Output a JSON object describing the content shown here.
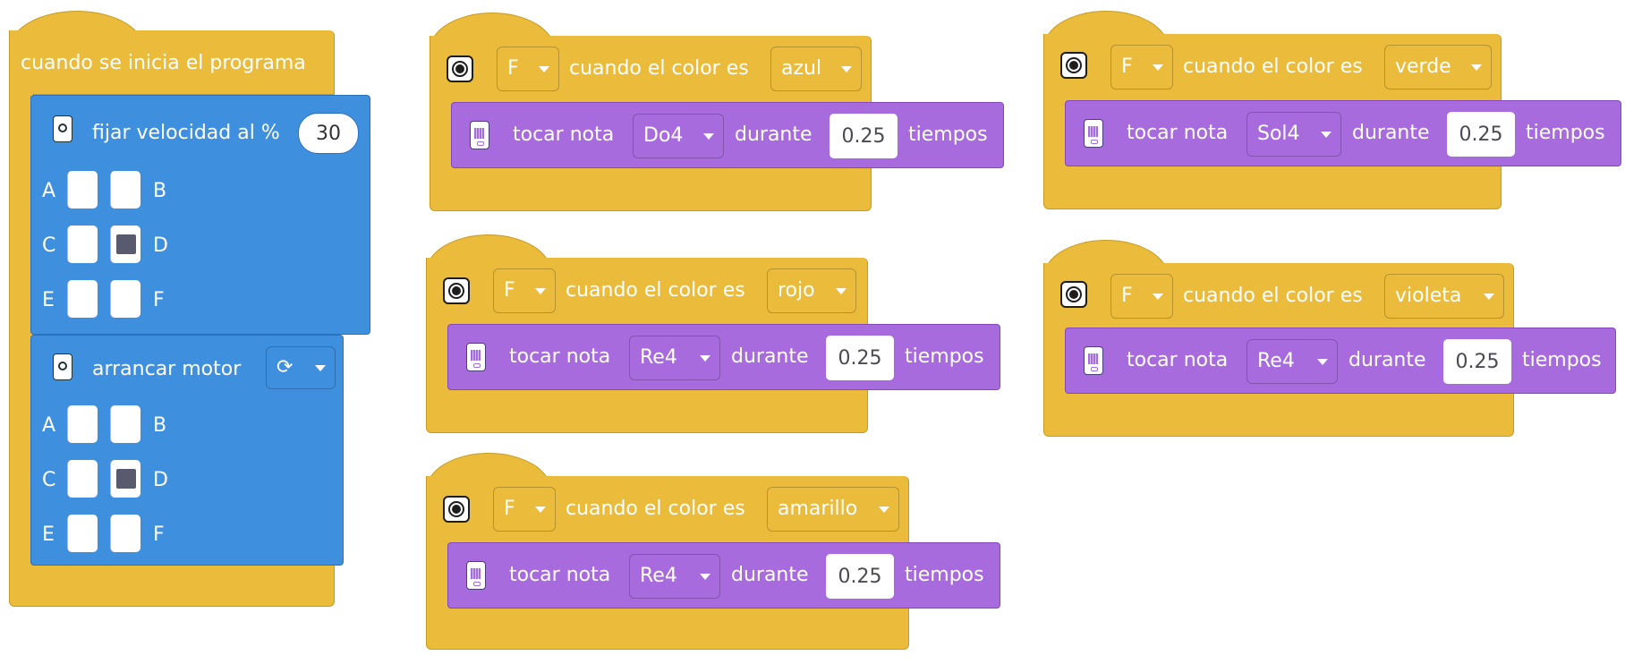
{
  "main_stack": {
    "hat_label": "cuando se inicia el programa",
    "speed_label": "fijar velocidad al %",
    "speed_value": "30",
    "start_label": "arrancar motor",
    "ports": [
      "A",
      "B",
      "C",
      "D",
      "E",
      "F"
    ],
    "selected_port": "D"
  },
  "color_events": [
    {
      "port": "F",
      "label": "cuando el color es",
      "color": "azul",
      "play": "tocar nota",
      "note": "Do4",
      "for": "durante",
      "beats": "0.25",
      "unit": "tiempos"
    },
    {
      "port": "F",
      "label": "cuando el color es",
      "color": "rojo",
      "play": "tocar nota",
      "note": "Re4",
      "for": "durante",
      "beats": "0.25",
      "unit": "tiempos"
    },
    {
      "port": "F",
      "label": "cuando el color es",
      "color": "amarillo",
      "play": "tocar nota",
      "note": "Re4",
      "for": "durante",
      "beats": "0.25",
      "unit": "tiempos"
    },
    {
      "port": "F",
      "label": "cuando el color es",
      "color": "verde",
      "play": "tocar nota",
      "note": "Sol4",
      "for": "durante",
      "beats": "0.25",
      "unit": "tiempos"
    },
    {
      "port": "F",
      "label": "cuando el color es",
      "color": "violeta",
      "play": "tocar nota",
      "note": "Re4",
      "for": "durante",
      "beats": "0.25",
      "unit": "tiempos"
    }
  ],
  "colors": {
    "event_yellow": "#ebbb3b",
    "sound_purple": "#a86bde",
    "motor_blue": "#3f8fdf"
  },
  "icons": [
    "color-sensor-icon",
    "hub-speaker-icon",
    "motor-icon",
    "rotate-clockwise-icon",
    "dropdown-caret-icon"
  ]
}
